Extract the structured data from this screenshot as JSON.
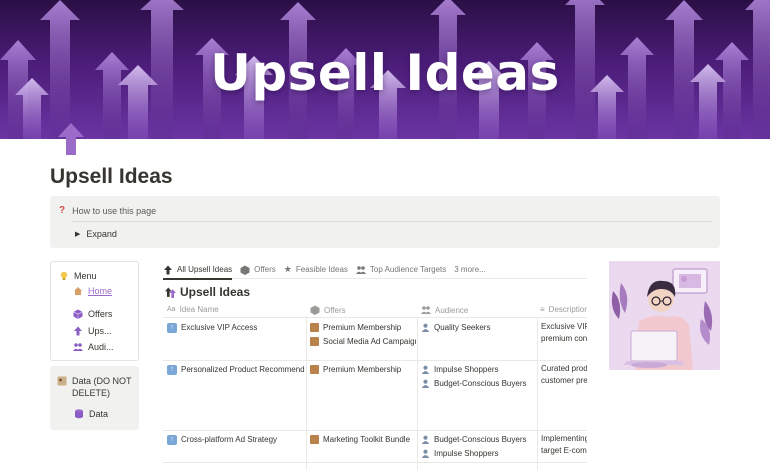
{
  "banner": {
    "title": "Upsell Ideas"
  },
  "page": {
    "title": "Upsell Ideas"
  },
  "callout": {
    "heading": "How to use this page",
    "toggle_label": "Expand"
  },
  "sidebar": {
    "menu": {
      "label": "Menu",
      "items": [
        {
          "label": "Home",
          "icon": "house-icon"
        },
        {
          "label": "Offers",
          "icon": "cube-icon"
        },
        {
          "label": "Ups...",
          "icon": "arrow-up-icon"
        },
        {
          "label": "Audi...",
          "icon": "people-icon"
        }
      ]
    },
    "data": {
      "label": "Data (DO NOT DELETE)",
      "item": "Data"
    }
  },
  "tabs": [
    {
      "label": "All Upsell Ideas",
      "icon": "arrow-up-icon",
      "active": true
    },
    {
      "label": "Offers",
      "icon": "cube-icon"
    },
    {
      "label": "Feasible Ideas",
      "icon": "star-icon"
    },
    {
      "label": "Top Audience Targets",
      "icon": "people-icon"
    },
    {
      "label": "3 more...",
      "icon": ""
    }
  ],
  "database": {
    "title": "Upsell Ideas"
  },
  "table": {
    "columns": [
      "Idea Name",
      "Offers",
      "Audience",
      "Description"
    ],
    "rows": [
      {
        "name": "Exclusive VIP Access",
        "offers": [
          "Premium Membership",
          "Social Media Ad Campaign"
        ],
        "audience": [
          "Quality Seekers"
        ],
        "description": [
          "Exclusive VIP",
          "premium con"
        ]
      },
      {
        "name": "Personalized Product Recommendations",
        "offers": [
          "Premium Membership"
        ],
        "audience": [
          "Impulse Shoppers",
          "Budget-Conscious Buyers"
        ],
        "description": [
          "Curated prod",
          "customer pre"
        ]
      },
      {
        "name": "Cross-platform Ad Strategy",
        "offers": [
          "Marketing Toolkit Bundle"
        ],
        "audience": [
          "Budget-Conscious Buyers",
          "Impulse Shoppers"
        ],
        "description": [
          "Implementing",
          "target E-com"
        ]
      }
    ]
  },
  "colors": {
    "banner": "#4b1d78",
    "accent_purple": "#9b6bc9",
    "callout_bg": "#f1f1ef"
  }
}
